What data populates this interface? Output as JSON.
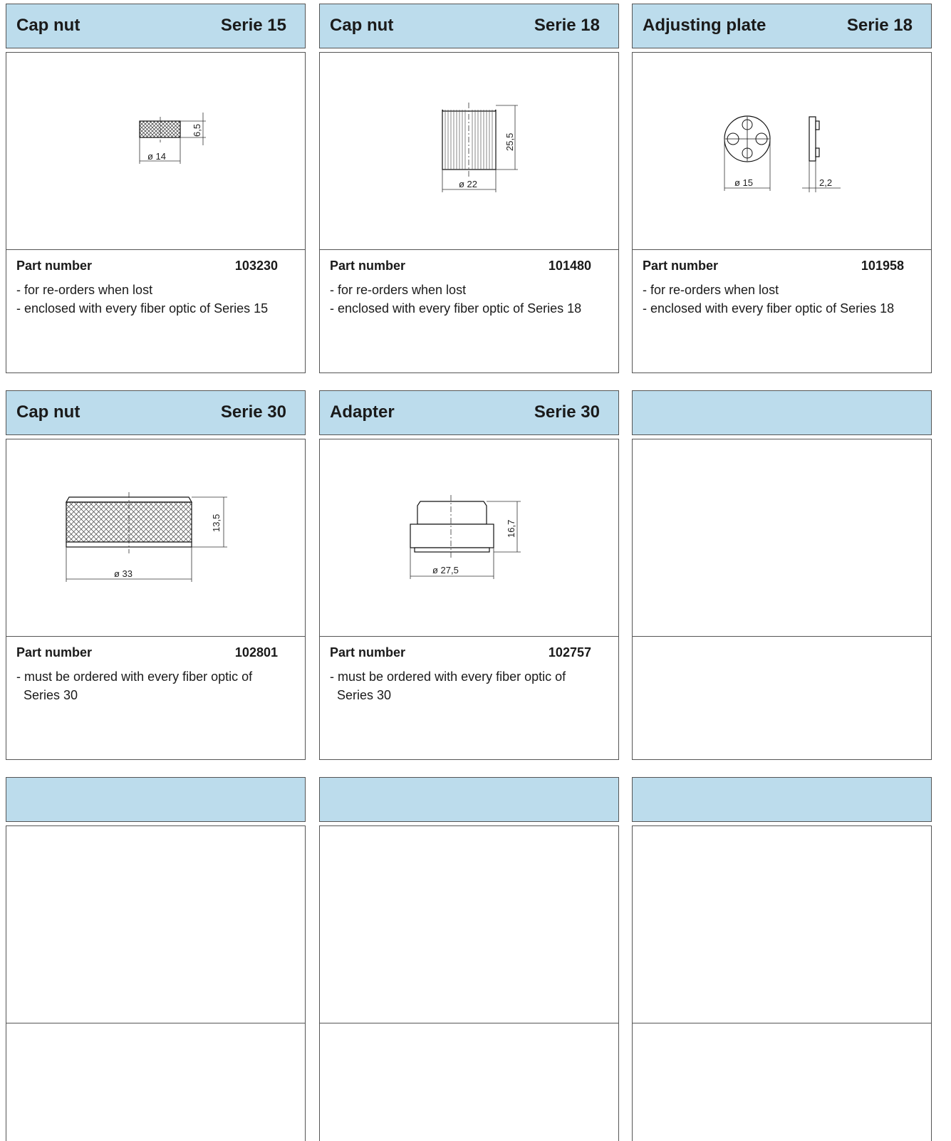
{
  "cards": [
    {
      "title": "Cap nut",
      "series": "Serie 15",
      "part_label": "Part number",
      "part_number": "103230",
      "lines": [
        "- for re-orders when lost",
        "- enclosed with every fiber optic of Series 15"
      ],
      "dims": [
        "ø 14",
        "6,5"
      ]
    },
    {
      "title": "Cap nut",
      "series": "Serie 18",
      "part_label": "Part number",
      "part_number": "101480",
      "lines": [
        "- for re-orders when lost",
        "- enclosed with every fiber optic of Series 18"
      ],
      "dims": [
        "ø 22",
        "25,5"
      ]
    },
    {
      "title": "Adjusting plate",
      "series": "Serie 18",
      "part_label": "Part number",
      "part_number": "101958",
      "lines": [
        "- for re-orders when lost",
        "- enclosed with every fiber optic of Series 18"
      ],
      "dims": [
        "ø 15",
        "2,2"
      ]
    },
    {
      "title": "Cap nut",
      "series": "Serie 30",
      "part_label": "Part number",
      "part_number": "102801",
      "lines": [
        "- must be ordered with every fiber optic of",
        "Series 30"
      ],
      "dims": [
        "ø 33",
        "13,5"
      ]
    },
    {
      "title": "Adapter",
      "series": "Serie 30",
      "part_label": "Part number",
      "part_number": "102757",
      "lines": [
        "- must be ordered with every fiber optic of",
        "Series 30"
      ],
      "dims": [
        "ø 27,5",
        "16,7"
      ]
    },
    {
      "title": "",
      "series": "",
      "part_label": "",
      "part_number": "",
      "lines": [
        "",
        ""
      ],
      "dims": []
    },
    {
      "title": "",
      "series": "",
      "part_label": "",
      "part_number": "",
      "lines": [
        "",
        ""
      ],
      "dims": []
    },
    {
      "title": "",
      "series": "",
      "part_label": "",
      "part_number": "",
      "lines": [
        "",
        ""
      ],
      "dims": []
    },
    {
      "title": "",
      "series": "",
      "part_label": "",
      "part_number": "",
      "lines": [
        "",
        ""
      ],
      "dims": []
    }
  ],
  "colors": {
    "header_bg": "#bcdcec",
    "border": "#555555"
  }
}
